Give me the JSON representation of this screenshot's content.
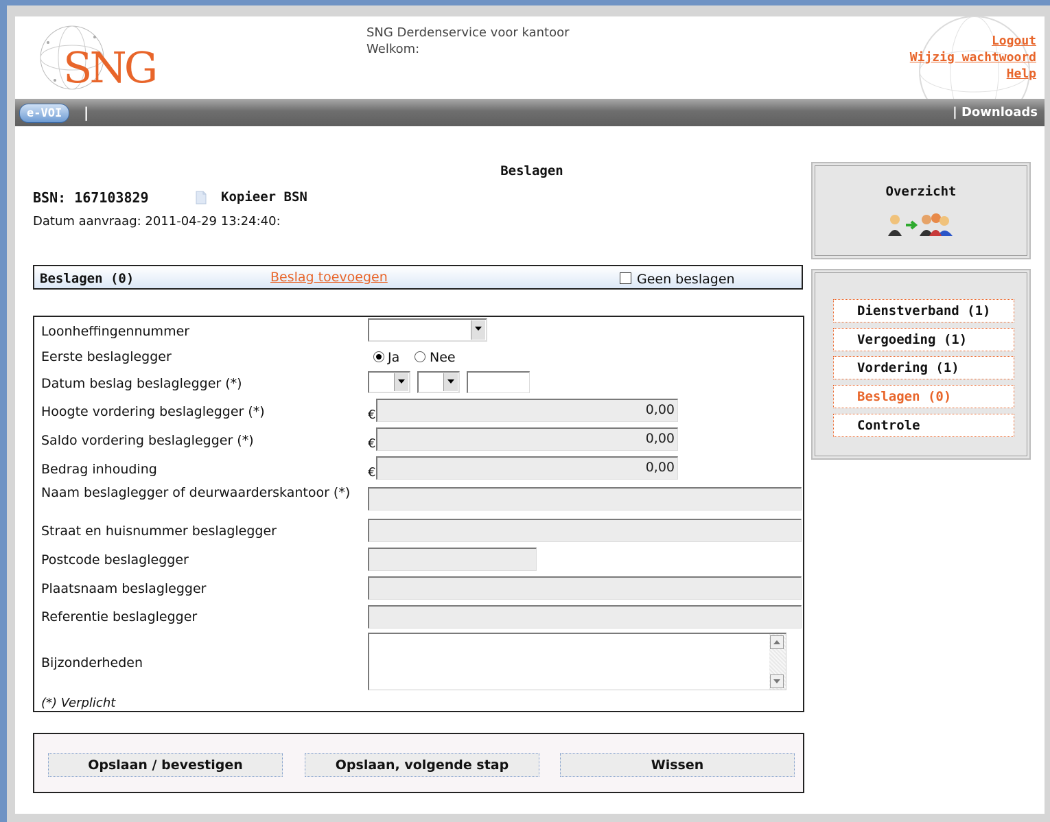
{
  "header": {
    "logo_text": "SNG",
    "app_title": "SNG Derdenservice voor kantoor",
    "welcome": "Welkom:",
    "links": [
      "Logout",
      "Wijzig wachtwoord",
      "Help"
    ]
  },
  "navbar": {
    "evoi": "e-VOI",
    "separator": "|",
    "downloads": "| Downloads"
  },
  "page": {
    "title": "Beslagen",
    "bsn": "BSN: 167103829",
    "copy_bsn": "Kopieer BSN",
    "datum": "Datum aanvraag: 2011-04-29 13:24:40:"
  },
  "section": {
    "title": "Beslagen (0)",
    "add_link": "Beslag toevoegen",
    "geen_label": "Geen beslagen"
  },
  "form": {
    "loonheffingennummer": "Loonheffingennummer",
    "eerste_beslaglegger": "Eerste beslaglegger",
    "radio_ja": "Ja",
    "radio_nee": "Nee",
    "datum_beslag": "Datum beslag beslaglegger (*)",
    "hoogte_vordering": "Hoogte vordering beslaglegger (*)",
    "saldo_vordering": "Saldo vordering beslaglegger (*)",
    "bedrag_inhouding": "Bedrag inhouding",
    "naam_beslaglegger": "Naam beslaglegger of deurwaarderskantoor (*)",
    "straat": "Straat en huisnummer beslaglegger",
    "postcode": "Postcode beslaglegger",
    "plaatsnaam": "Plaatsnaam beslaglegger",
    "referentie": "Referentie beslaglegger",
    "bijzonderheden": "Bijzonderheden",
    "euro": "€",
    "hoogte_value": "0,00",
    "saldo_value": "0,00",
    "bedrag_value": "0,00",
    "verplicht": "(*) Verplicht"
  },
  "buttons": {
    "save_confirm": "Opslaan / bevestigen",
    "save_next": "Opslaan, volgende stap",
    "clear": "Wissen"
  },
  "sidebar": {
    "overview_title": "Overzicht",
    "steps": [
      {
        "label": "Dienstverband (1)"
      },
      {
        "label": "Vergoeding (1)"
      },
      {
        "label": "Vordering (1)"
      },
      {
        "label": "Beslagen (0)"
      },
      {
        "label": "Controle"
      }
    ]
  },
  "colors": {
    "accent": "#e8652a",
    "frame": "#6f93c4",
    "navbar": "#6e6e6e"
  }
}
